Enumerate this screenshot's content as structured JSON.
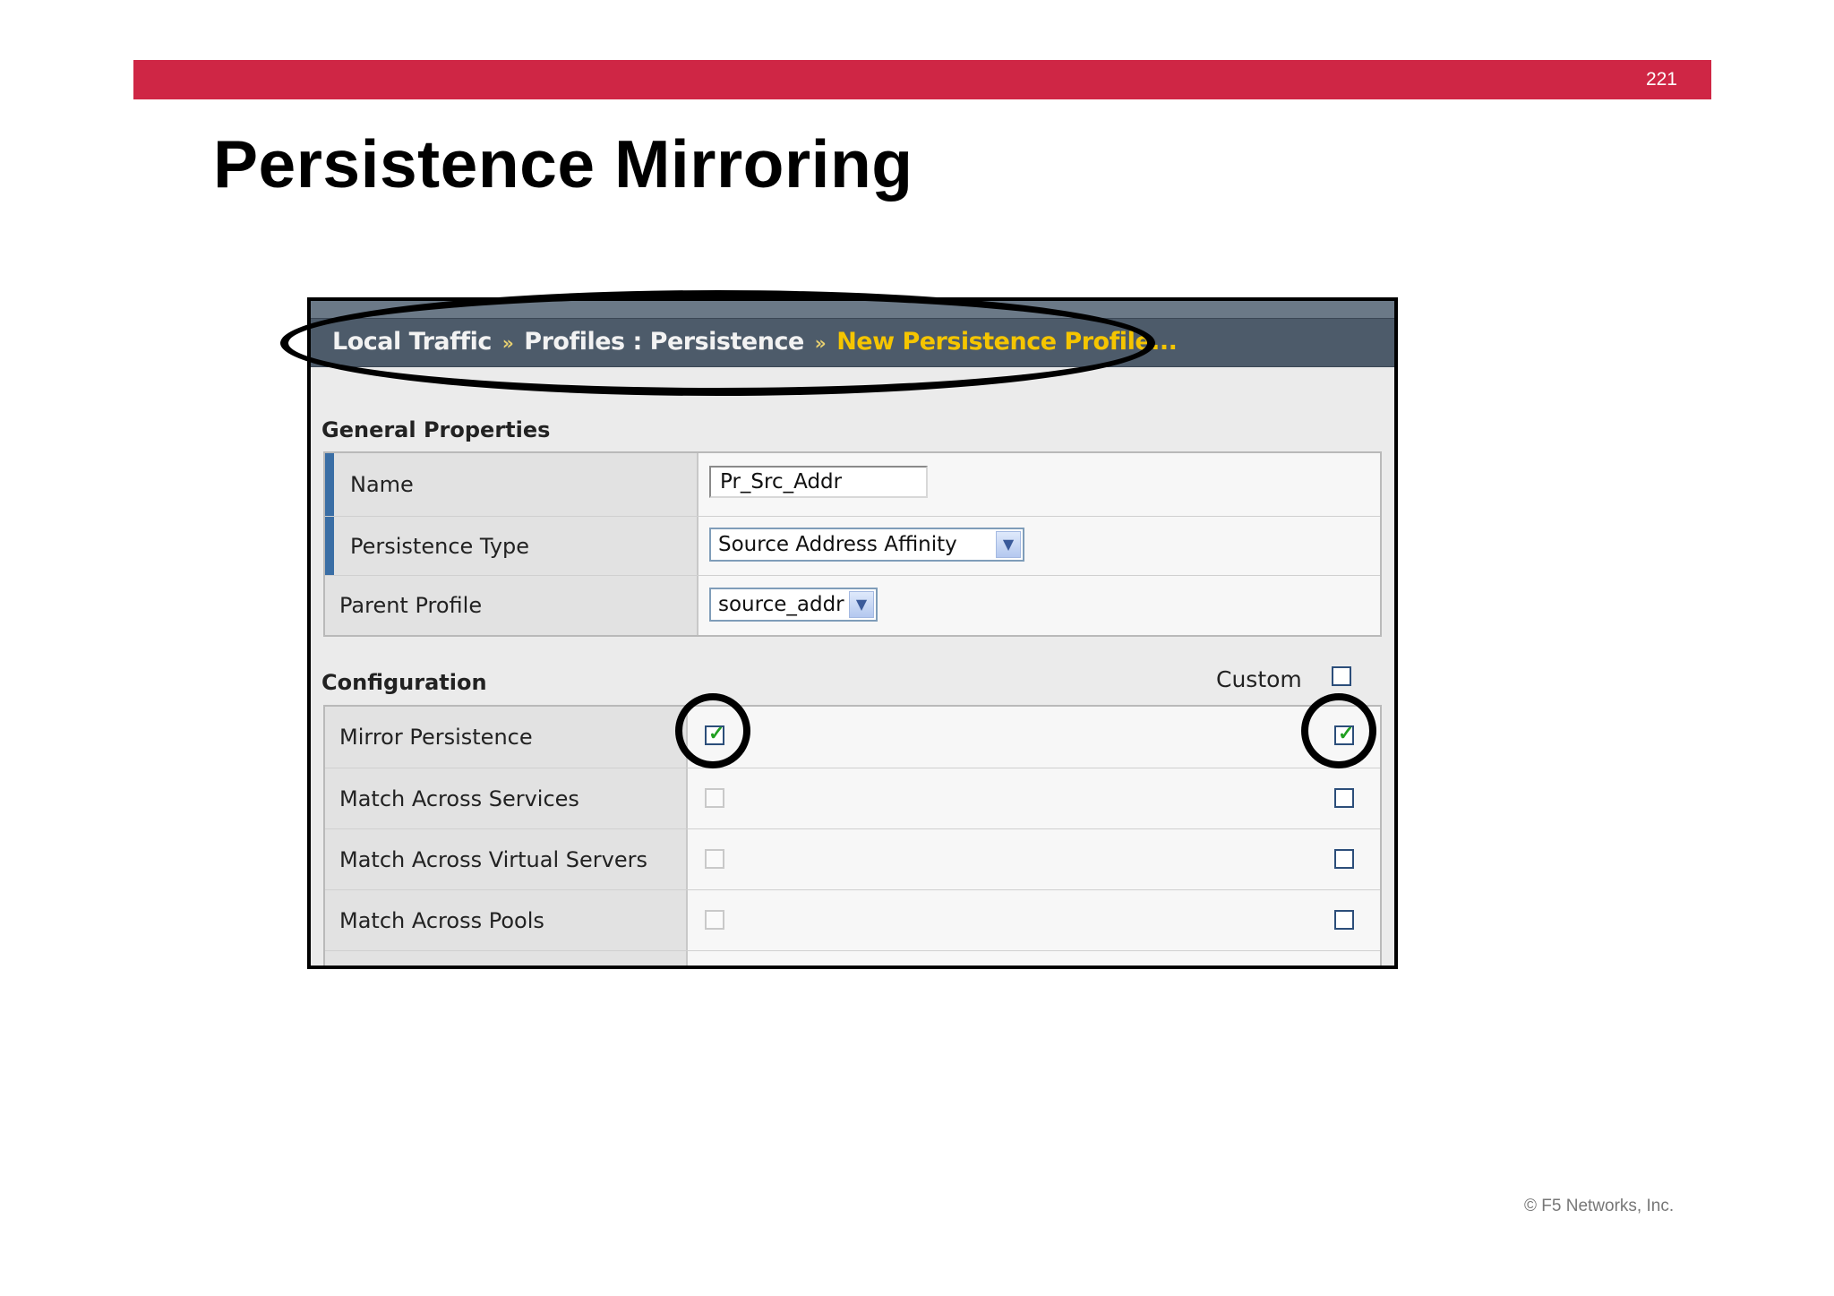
{
  "slide": {
    "number": "221",
    "title": "Persistence Mirroring",
    "footer": "© F5 Networks, Inc."
  },
  "breadcrumb": {
    "items": [
      "Local Traffic",
      "Profiles : Persistence"
    ],
    "separator": "»",
    "current": "New Persistence Profile..."
  },
  "general": {
    "title": "General Properties",
    "name_label": "Name",
    "name_value": "Pr_Src_Addr",
    "type_label": "Persistence Type",
    "type_value": "Source Address Affinity",
    "parent_label": "Parent Profile",
    "parent_value": "source_addr"
  },
  "configuration": {
    "title": "Configuration",
    "custom_label": "Custom",
    "rows": [
      {
        "label": "Mirror Persistence",
        "checked": true,
        "custom": true
      },
      {
        "label": "Match Across Services",
        "checked": false,
        "custom": false
      },
      {
        "label": "Match Across Virtual Servers",
        "checked": false,
        "custom": false
      },
      {
        "label": "Match Across Pools",
        "checked": false,
        "custom": false
      }
    ]
  },
  "colors": {
    "header_bar": "#cf2645",
    "breadcrumb_bg": "#4d5b6a",
    "breadcrumb_current": "#f5c500",
    "required_marker": "#3a6ea5",
    "check": "#22a022"
  }
}
